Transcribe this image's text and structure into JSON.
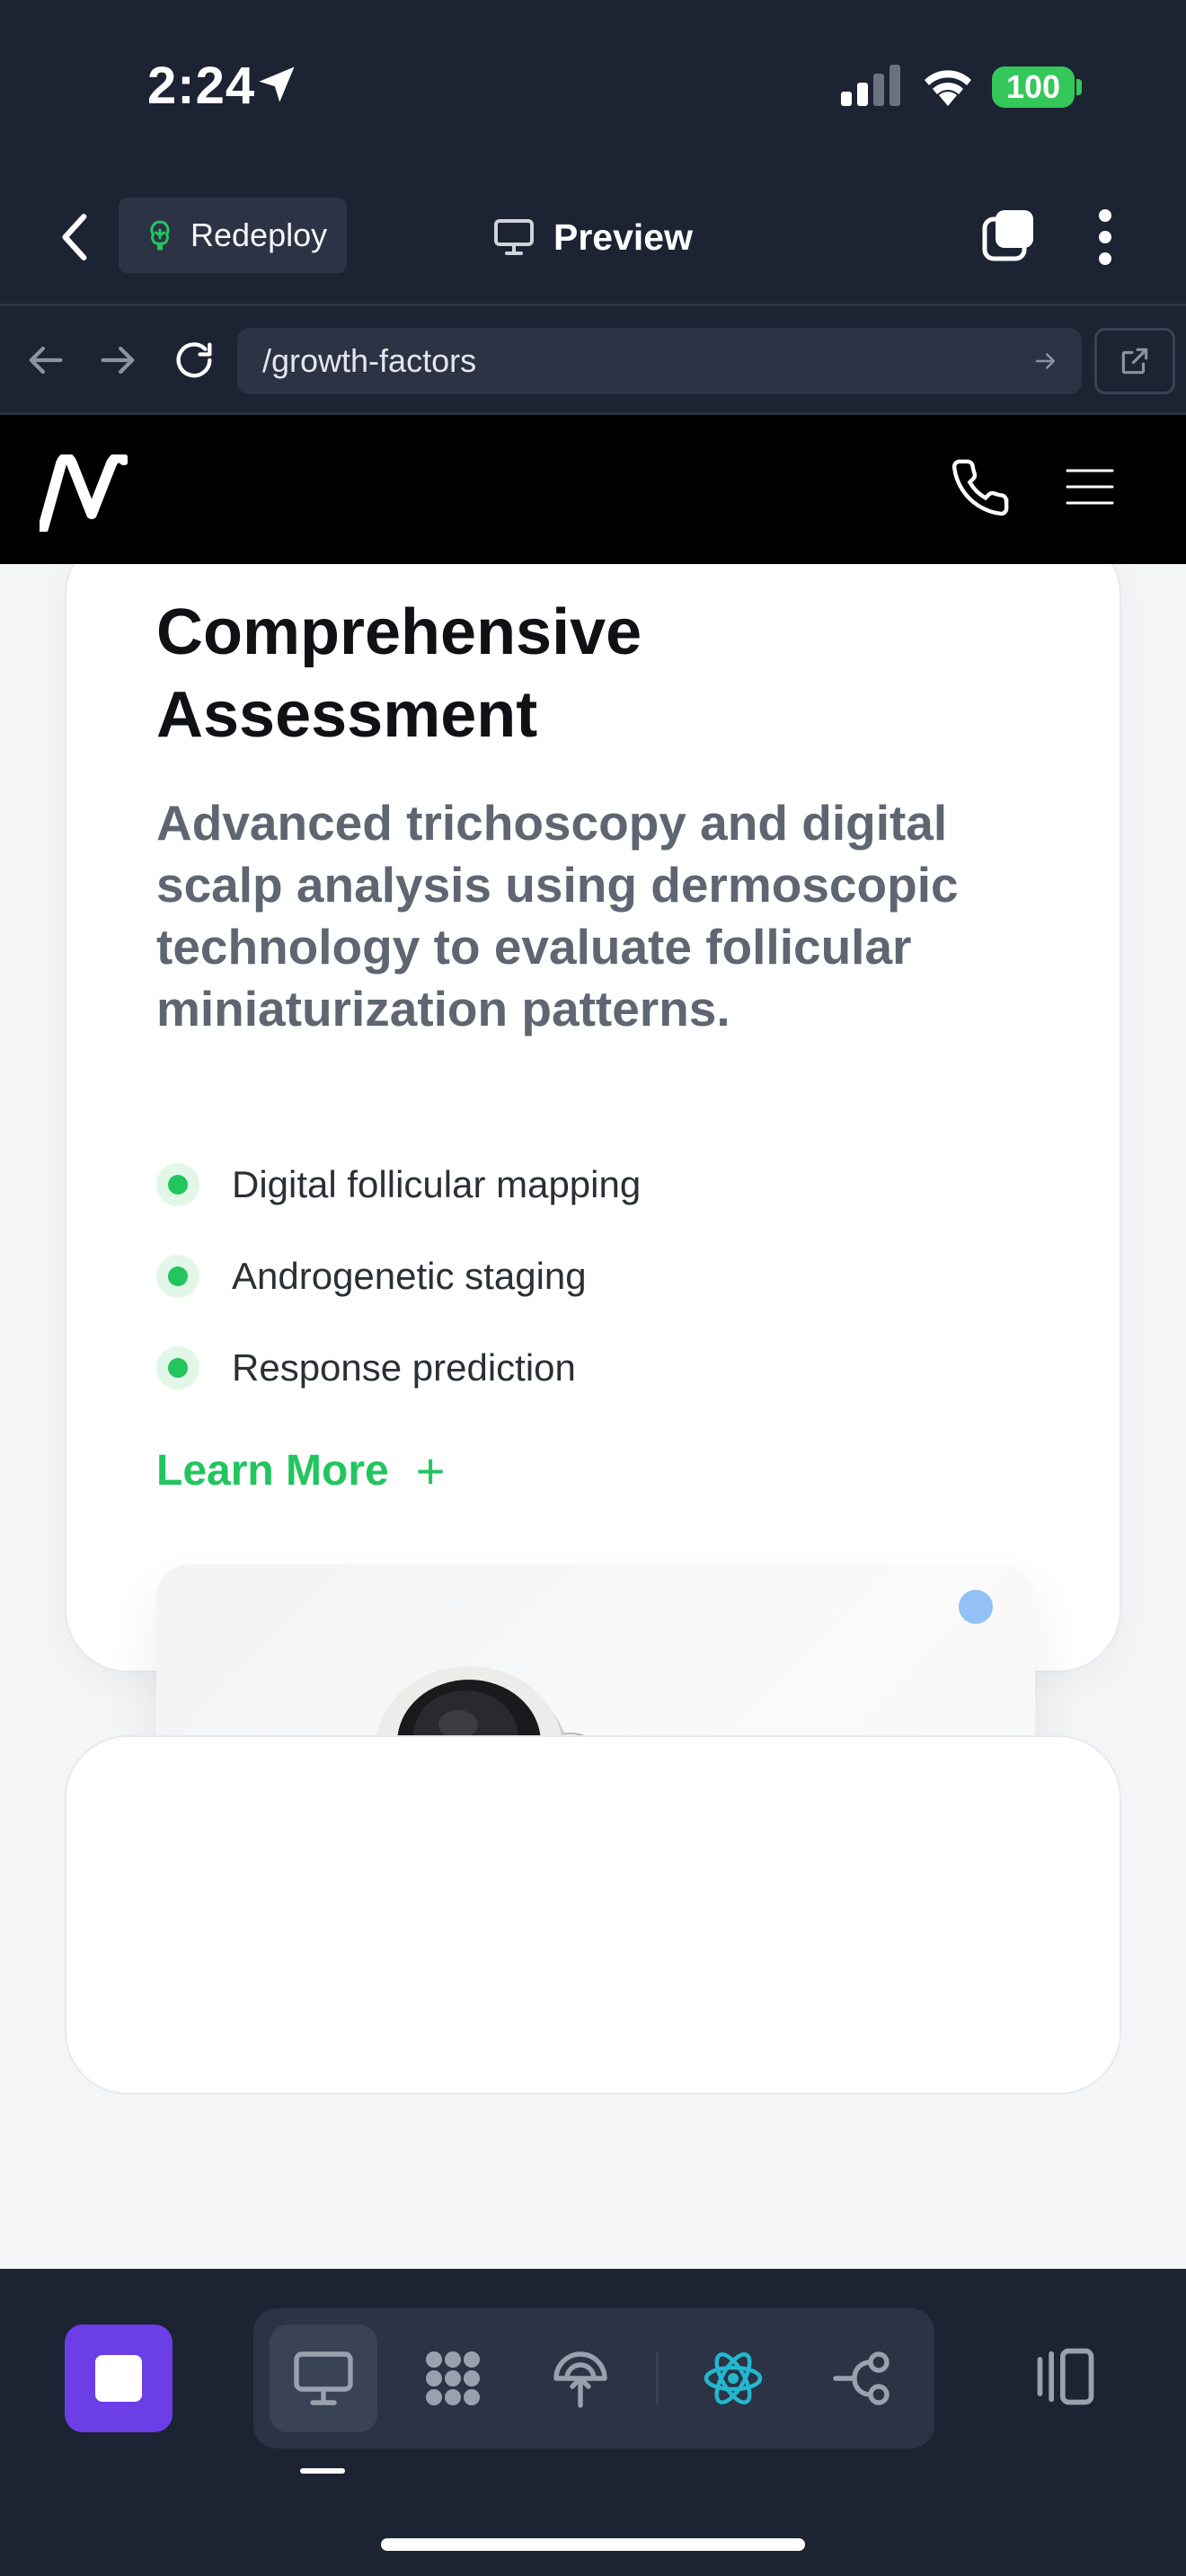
{
  "status_bar": {
    "time": "2:24",
    "battery": "100"
  },
  "top_bar": {
    "redeploy_label": "Redeploy",
    "title": "Preview"
  },
  "url_bar": {
    "url": "/growth-factors"
  },
  "card": {
    "title": "Comprehensive Assessment",
    "description": "Advanced trichoscopy and digital scalp analysis using dermoscopic technology to evaluate follicular miniaturization patterns.",
    "features": [
      "Digital follicular mapping",
      "Androgenetic staging",
      "Response prediction"
    ],
    "cta_label": "Learn More",
    "cta_icon": "+"
  },
  "colors": {
    "app_background": "#1c2333",
    "accent_green": "#22c55e",
    "stop_button": "#6c3ee6",
    "battery_green": "#34c759"
  },
  "icons": {
    "back": "chevron-left-icon",
    "redeploy": "tree-icon",
    "preview": "monitor-icon",
    "tabs": "tabs-icon",
    "more": "more-vertical-icon",
    "nav_back": "arrow-left-icon",
    "nav_forward": "arrow-right-icon",
    "reload": "reload-icon",
    "open_external": "external-link-icon",
    "tools": [
      "monitor-icon",
      "blocks-icon",
      "deploy-icon",
      "react-icon",
      "git-icon"
    ],
    "layout": "layout-icon"
  }
}
